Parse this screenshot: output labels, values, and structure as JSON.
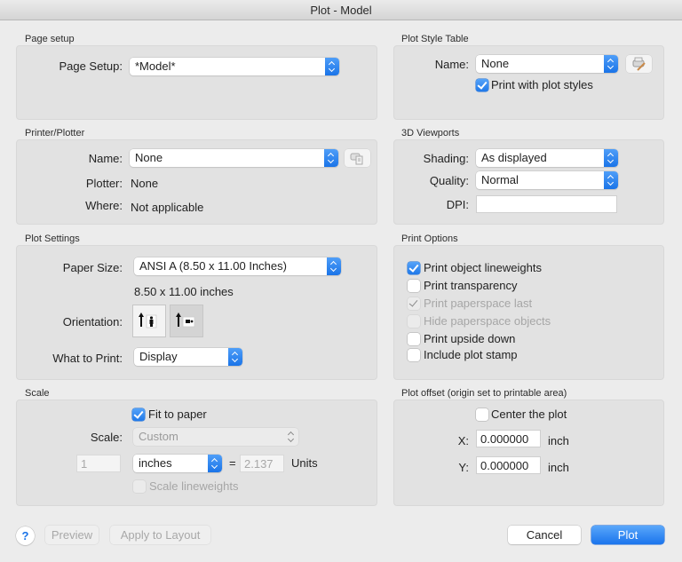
{
  "window": {
    "title": "Plot - Model"
  },
  "page_setup": {
    "section_label": "Page setup",
    "label": "Page Setup:",
    "value": "*Model*"
  },
  "plot_style_table": {
    "section_label": "Plot Style Table",
    "name_label": "Name:",
    "name_value": "None",
    "edit_icon": "printer-edit-icon",
    "print_with_styles_label": "Print with plot styles",
    "print_with_styles_checked": true
  },
  "printer_plotter": {
    "section_label": "Printer/Plotter",
    "name_label": "Name:",
    "name_value": "None",
    "properties_icon": "printer-properties-icon",
    "plotter_label": "Plotter:",
    "plotter_value": "None",
    "where_label": "Where:",
    "where_value": "Not applicable"
  },
  "viewports_3d": {
    "section_label": "3D Viewports",
    "shading_label": "Shading:",
    "shading_value": "As displayed",
    "quality_label": "Quality:",
    "quality_value": "Normal",
    "dpi_label": "DPI:",
    "dpi_value": ""
  },
  "plot_settings": {
    "section_label": "Plot Settings",
    "paper_size_label": "Paper Size:",
    "paper_size_value": "ANSI A (8.50 x 11.00 Inches)",
    "paper_dimensions": "8.50 x 11.00 inches",
    "orientation_label": "Orientation:",
    "orientation_options": [
      "portrait",
      "landscape"
    ],
    "orientation_selected": "landscape",
    "what_to_print_label": "What to Print:",
    "what_to_print_value": "Display"
  },
  "print_options": {
    "section_label": "Print Options",
    "items": [
      {
        "label": "Print object lineweights",
        "checked": true,
        "enabled": true
      },
      {
        "label": "Print transparency",
        "checked": false,
        "enabled": true
      },
      {
        "label": "Print paperspace last",
        "checked": true,
        "enabled": false
      },
      {
        "label": "Hide paperspace objects",
        "checked": false,
        "enabled": false
      },
      {
        "label": "Print upside down",
        "checked": false,
        "enabled": true
      },
      {
        "label": "Include plot stamp",
        "checked": false,
        "enabled": true
      }
    ]
  },
  "scale": {
    "section_label": "Scale",
    "fit_to_paper_label": "Fit to paper",
    "fit_to_paper_checked": true,
    "scale_label": "Scale:",
    "scale_value": "Custom",
    "paper_units_value": "1",
    "units_select_value": "inches",
    "equals": "=",
    "drawing_units_value": "2.137",
    "units_label": "Units",
    "scale_lineweights_label": "Scale lineweights",
    "scale_lineweights_checked": false
  },
  "plot_offset": {
    "section_label": "Plot offset (origin set to printable area)",
    "center_label": "Center the plot",
    "center_checked": false,
    "x_label": "X:",
    "x_value": "0.000000",
    "x_unit": "inch",
    "y_label": "Y:",
    "y_value": "0.000000",
    "y_unit": "inch"
  },
  "footer": {
    "help_label": "?",
    "preview_label": "Preview",
    "apply_label": "Apply to Layout",
    "cancel_label": "Cancel",
    "plot_label": "Plot"
  },
  "colors": {
    "accent": "#1a74e8"
  }
}
